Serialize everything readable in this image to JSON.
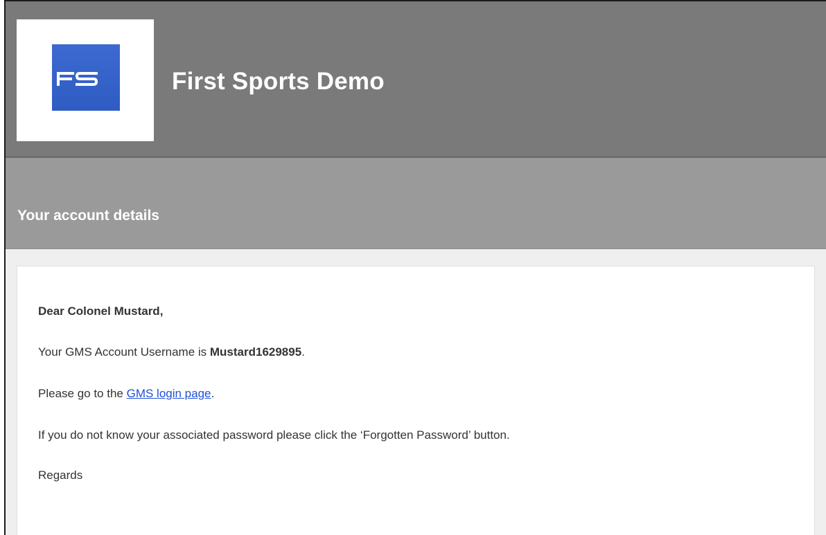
{
  "header": {
    "logo_text": "FS",
    "site_title": "First Sports Demo"
  },
  "subheader": {
    "title": "Your account details"
  },
  "message": {
    "greeting": "Dear Colonel Mustard,",
    "username_prefix": "Your GMS Account Username is ",
    "username": "Mustard1629895",
    "username_suffix": ".",
    "login_prefix": "Please go to the ",
    "login_link": "GMS login page",
    "login_suffix": ".",
    "password_line": "If you do not know your associated password please click the ‘Forgotten Password’ button.",
    "regards": "Regards"
  },
  "colors": {
    "header_bg": "#7a7a7a",
    "subheader_bg": "#9a9a9a",
    "logo_blue": "#3563c9",
    "link": "#1f4fd8"
  }
}
